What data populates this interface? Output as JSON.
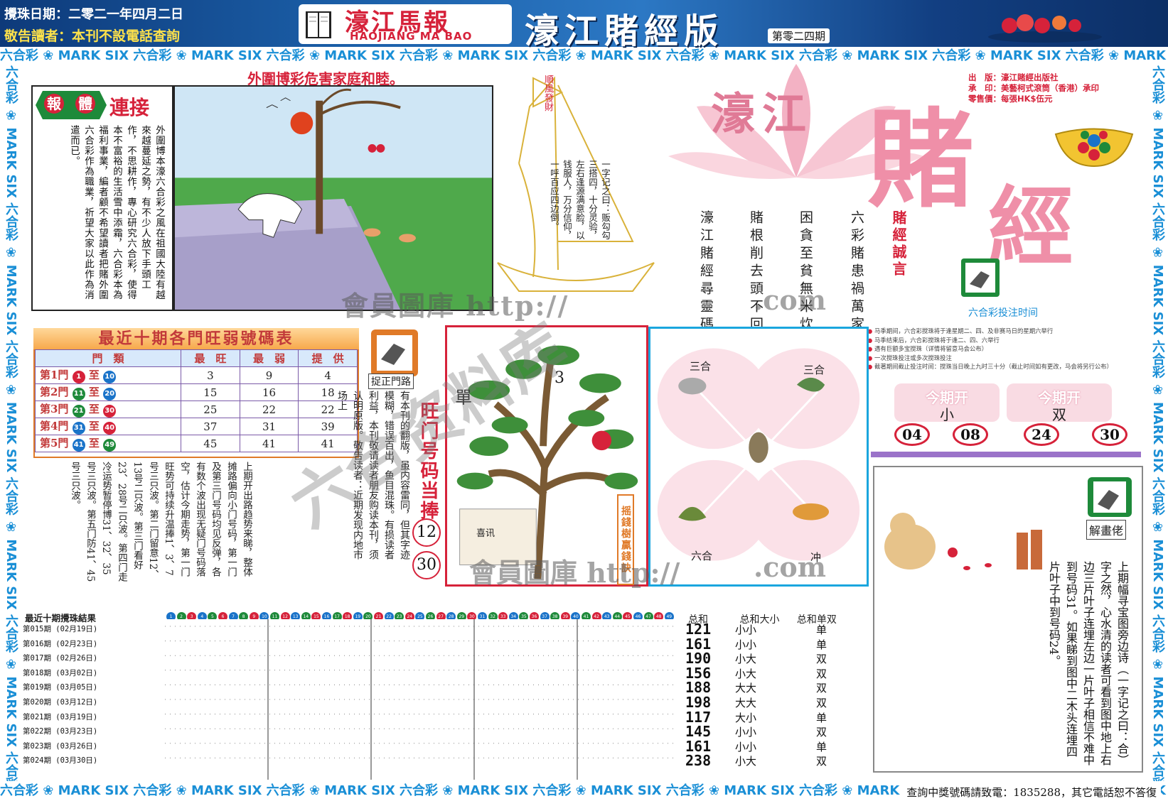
{
  "header": {
    "draw_date": "攪珠日期：二零二一年四月二日",
    "notice": "敬告讀者：本刊不設電話查詢",
    "brand_cn": "濠江馬報",
    "brand_en": "HAOJIANG MA BAO",
    "edition_title": "濠江賭經版",
    "issue_no": "第零二四期"
  },
  "border_text": "六合彩 ❀ MARK SIX ",
  "hotline": "查詢中獎號碼請致電：1835288，其它電話恕不答復",
  "main_story": {
    "title": "外圍博彩危害家庭和睦。",
    "badge_chars": [
      "報",
      "體"
    ],
    "badge_tail": "連接",
    "text": "外圍博本濠六合彩之風在祖國大陸有越來越蔓延之勢，有不少人放下手頭工作，不思耕作，專心研究六合彩，使得本不富裕的生活雪中添霜，六合彩本為福利事業，編者顧不希望讀者把賭外圍六合彩作為職業，祈望大家以此作為消遣而已。"
  },
  "ship": {
    "sail_text": "順風發財",
    "poem": "一字记之曰：贩勾勾三搭四，十分灵验，左右逢源满意脸，以钱服人，万分信仰，一呼百应四边倒。"
  },
  "big_title": {
    "line1": "濠江",
    "char_du": "賭",
    "char_jing": "經",
    "motto": "賭經誠言",
    "columns": [
      "六彩賭患禍萬家",
      "困貪至貧無米炊",
      "賭根削去頭不回",
      "濠江賭經尋靈碼"
    ]
  },
  "publisher": {
    "line1": "出　版：濠江賭經出版社",
    "line2": "承　印：美藝柯式滾筒（香港）承印",
    "line3": "零售價：每張HK$伍元"
  },
  "betting": {
    "label": "六合彩投注时间",
    "rules": [
      "马季期间，六合彩搅珠将于逢星期二、四、及非赛马日的星期六举行",
      "马季结束后，六合彩搅珠将于逢二、四、六举行",
      "遇有巨额多宝搅珠（详情将留意马会公布）",
      "一次搅珠投注或多次搅珠投注",
      "截著期间截止投注时间：搅珠当日晚上九时三十分（截止时间如有更改，马会将另行公布）"
    ]
  },
  "hot_table": {
    "title": "最近十期各門旺弱號碼表",
    "headers": [
      "門　類",
      "最　旺",
      "最　弱",
      "提　供"
    ],
    "rows": [
      {
        "gate": "第1門",
        "from": "1",
        "to": "10",
        "hot": "3",
        "cold": "9",
        "tip": "4"
      },
      {
        "gate": "第2門",
        "from": "11",
        "to": "20",
        "hot": "15",
        "cold": "16",
        "tip": "18"
      },
      {
        "gate": "第3門",
        "from": "21",
        "to": "30",
        "hot": "25",
        "cold": "22",
        "tip": "22"
      },
      {
        "gate": "第4門",
        "from": "31",
        "to": "40",
        "hot": "37",
        "cold": "31",
        "tip": "39"
      },
      {
        "gate": "第5門",
        "from": "41",
        "to": "49",
        "hot": "45",
        "cold": "41",
        "tip": "41"
      }
    ],
    "to_word": "至"
  },
  "gate_side": {
    "label": "捉正門路",
    "text": "有本刊的翻版，虽内容雷同，但其字迹模糊，错误百出，鱼目混珠。有损读者利益，本刊敬请读者朋友购读本刊，须认明原版。敬告读者：近期发现内地市场上",
    "lucky_title": "旺门号码当捧",
    "lucky_numbers": [
      "12",
      "30"
    ]
  },
  "analysis": "上期开出路趋势来睇，整体摊路偏向小门号码，第一门及第三门号码均见反弹，各有数个波出现无疑门号码落空，估计今期走势，第一门旺势可持续升温捧1、3、7号三只波。第二门留意12、13号二只波。第三门看好23、28号二只波。第四门走冷运势暂停博31、32、35号三只波。第五门防41、45号三只波。",
  "tree": {
    "left_char": "單",
    "right_char": "3",
    "caption": "摇錢樹贏錢訣",
    "note": "喜讯"
  },
  "zodiac": {
    "top_left": "三合",
    "top_right": "三合",
    "bottom_left": "六合",
    "bottom_right": "冲"
  },
  "open_result": {
    "head1": "今期开",
    "val1": "小",
    "head2": "今期开",
    "val2": "双",
    "balls": [
      "04",
      "08",
      "24",
      "30"
    ]
  },
  "cartoon": {
    "label": "解畫佬",
    "text": "上期幅寻宝图旁边诗（一字记之曰：合）字之然，心水清的读者可看到图中地上右边三片叶子连埋左边一片叶子相信不难中到号码31。如果睇到图中二木头连埋四片叶子中到号码24。"
  },
  "results": {
    "header": "最近十期攪珠結果",
    "col_heads": [
      "总和",
      "总和大小",
      "总和单双"
    ],
    "rows": [
      {
        "label": "第015期 (02月19日)",
        "sum": "121",
        "size": "小小",
        "parity": "单"
      },
      {
        "label": "第016期 (02月23日)",
        "sum": "161",
        "size": "小小",
        "parity": "单"
      },
      {
        "label": "第017期 (02月26日)",
        "sum": "190",
        "size": "小大",
        "parity": "双"
      },
      {
        "label": "第018期 (03月02日)",
        "sum": "156",
        "size": "小大",
        "parity": "双"
      },
      {
        "label": "第019期 (03月05日)",
        "sum": "188",
        "size": "大大",
        "parity": "双"
      },
      {
        "label": "第020期 (03月12日)",
        "sum": "198",
        "size": "大大",
        "parity": "双"
      },
      {
        "label": "第021期 (03月19日)",
        "sum": "117",
        "size": "大小",
        "parity": "单"
      },
      {
        "label": "第022期 (03月23日)",
        "sum": "145",
        "size": "小小",
        "parity": "双"
      },
      {
        "label": "第023期 (03月26日)",
        "sum": "161",
        "size": "小小",
        "parity": "单"
      },
      {
        "label": "第024期 (03月30日)",
        "sum": "238",
        "size": "小大",
        "parity": "双"
      }
    ]
  },
  "watermark": {
    "line1": "六合资料库",
    "site_cn": "會員圖庫 http://",
    "site_com": ".com"
  },
  "colors": {
    "red": "#d6223a",
    "blue_band": "#1a8fd6",
    "header_blue": "#1b5fa8",
    "ball_red": "#d6223a",
    "ball_blue": "#1a73c9",
    "ball_green": "#1e8a3a"
  }
}
